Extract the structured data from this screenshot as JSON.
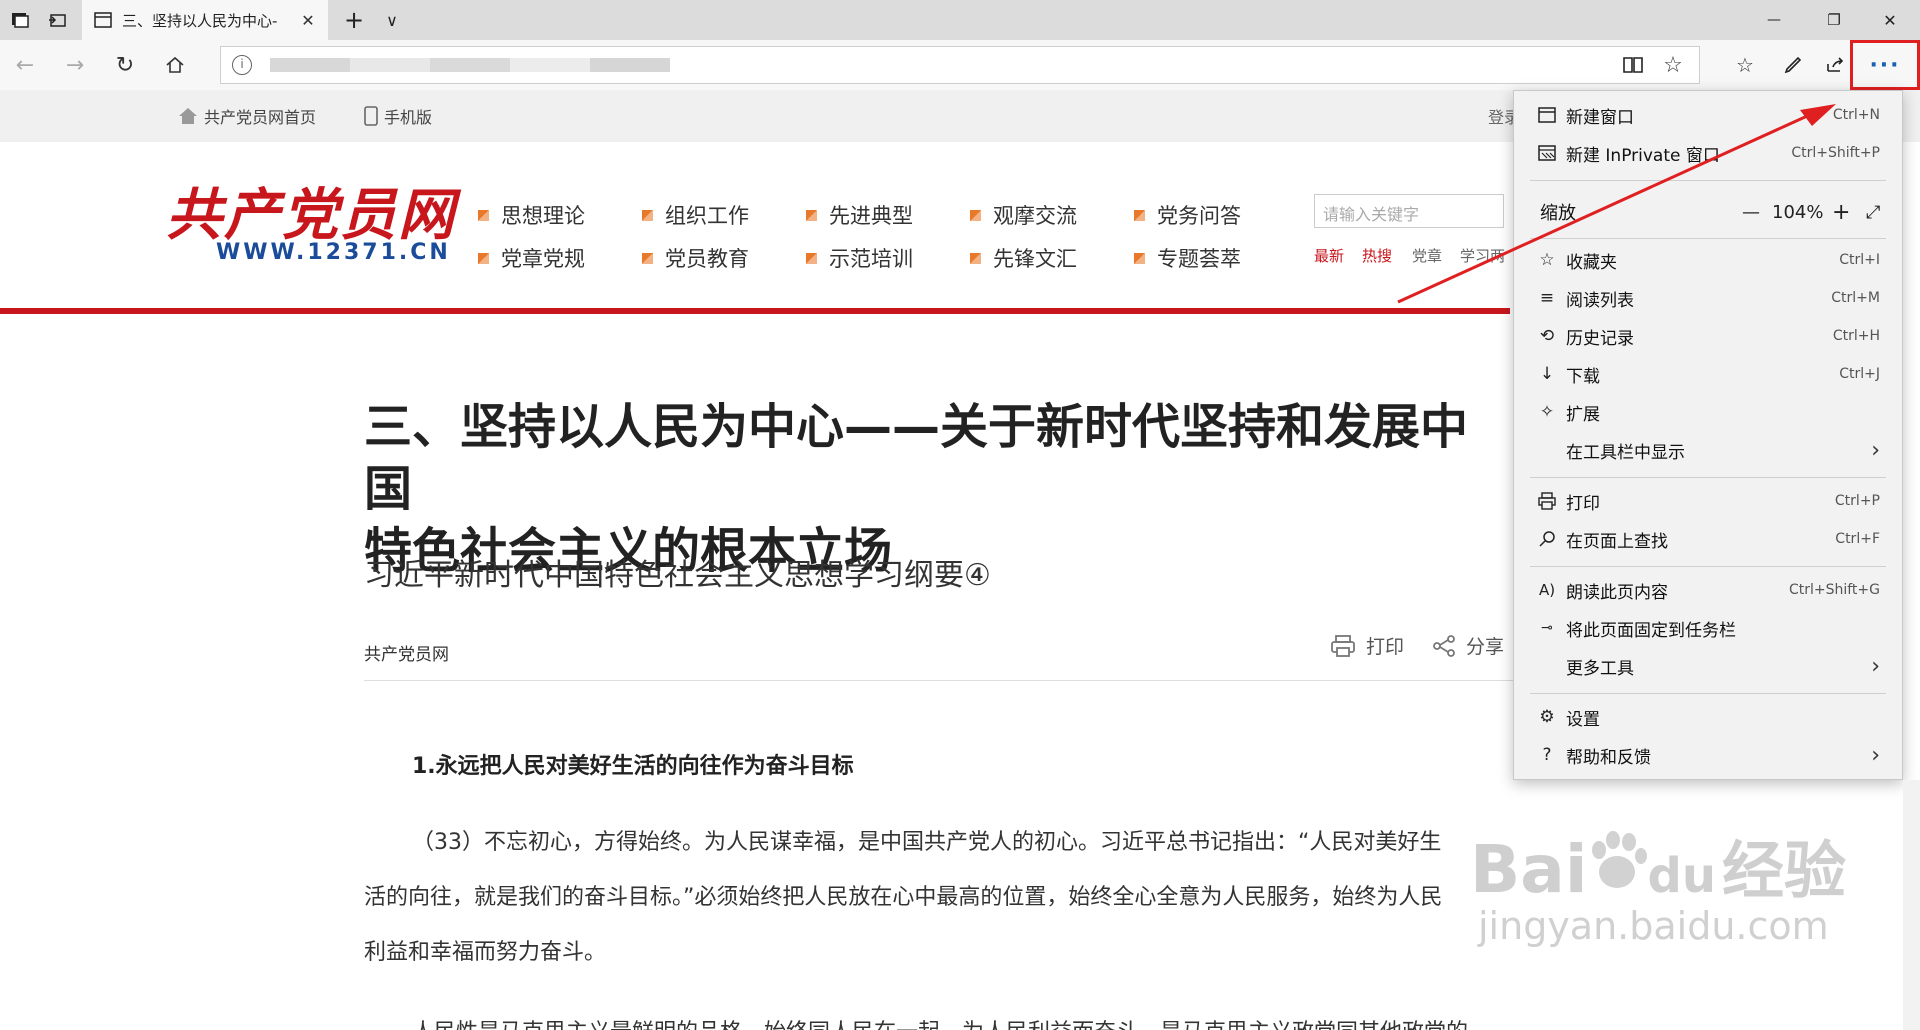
{
  "tabbar": {
    "tab_title": "三、坚持以人民为中心-",
    "new_tab": "+",
    "tab_list": "∨",
    "window": {
      "minimize": "—",
      "restore": "❐",
      "close": "✕"
    }
  },
  "addressbar": {
    "info_icon": "info-icon",
    "more_label": "···"
  },
  "favorites_bar": {
    "home_link": "共产党员网首页",
    "mobile_link": "手机版",
    "login_text": "登录"
  },
  "header": {
    "logo_text": "共产党员网",
    "logo_url": "WWW.12371.CN",
    "nav_row1": [
      "思想理论",
      "组织工作",
      "先进典型",
      "观摩交流",
      "党务问答"
    ],
    "nav_row2": [
      "党章党规",
      "党员教育",
      "示范培训",
      "先锋文汇",
      "专题荟萃"
    ],
    "search_placeholder": "请输入关键字",
    "hot_links": [
      "最新",
      "热搜",
      "党章",
      "学习两"
    ]
  },
  "article": {
    "title_line1": "三、坚持以人民为中心——关于新时代坚持和发展中国",
    "title_line2": "特色社会主义的根本立场",
    "subtitle": "习近平新时代中国特色社会主义思想学习纲要④",
    "source": "共产党员网",
    "print_label": "打印",
    "share_label": "分享",
    "section_heading": "1.永远把人民对美好生活的向往作为奋斗目标",
    "para1_line1": "（33）不忘初心，方得始终。为人民谋幸福，是中国共产党人的初心。习近平总书记指出：“人民对美好生",
    "para1_line2": "活的向往，就是我们的奋斗目标。”必须始终把人民放在心中最高的位置，始终全心全意为人民服务，始终为人民",
    "para1_line3": "利益和幸福而努力奋斗。",
    "para2_line1": "人民性是马克思主义最鲜明的品格。始终同人民在一起，为人民利益而奋斗，是马克思主义政党同其他政党的"
  },
  "menu": {
    "items": [
      {
        "label": "新建窗口",
        "shortcut": "Ctrl+N",
        "icon": "window-icon"
      },
      {
        "label": "新建 InPrivate 窗口",
        "shortcut": "Ctrl+Shift+P",
        "icon": "inprivate-icon"
      },
      {
        "label": "收藏夹",
        "shortcut": "Ctrl+I",
        "icon": "favorites-icon"
      },
      {
        "label": "阅读列表",
        "shortcut": "Ctrl+M",
        "icon": "reading-list-icon"
      },
      {
        "label": "历史记录",
        "shortcut": "Ctrl+H",
        "icon": "history-icon"
      },
      {
        "label": "下载",
        "shortcut": "Ctrl+J",
        "icon": "download-icon"
      },
      {
        "label": "扩展",
        "shortcut": "",
        "icon": "extensions-icon"
      },
      {
        "label": "在工具栏中显示",
        "shortcut": "",
        "icon": ""
      },
      {
        "label": "打印",
        "shortcut": "Ctrl+P",
        "icon": "print-icon"
      },
      {
        "label": "在页面上查找",
        "shortcut": "Ctrl+F",
        "icon": "find-icon"
      },
      {
        "label": "朗读此页内容",
        "shortcut": "Ctrl+Shift+G",
        "icon": "read-aloud-icon"
      },
      {
        "label": "将此页面固定到任务栏",
        "shortcut": "",
        "icon": "pin-icon"
      },
      {
        "label": "更多工具",
        "shortcut": "",
        "icon": ""
      },
      {
        "label": "设置",
        "shortcut": "",
        "icon": "settings-icon"
      },
      {
        "label": "帮助和反馈",
        "shortcut": "",
        "icon": "help-icon"
      }
    ],
    "zoom": {
      "label": "缩放",
      "minus": "—",
      "value": "104%",
      "plus": "+",
      "fullscreen": "⤢"
    }
  },
  "watermark": {
    "brand": "Bai",
    "du": "du",
    "cn": "经验",
    "url": "jingyan.baidu.com"
  },
  "colors": {
    "accent_red": "#c8161d",
    "highlight_box": "#e02020",
    "logo_blue": "#1a4c9a",
    "edge_blue": "#1a5fb4"
  }
}
